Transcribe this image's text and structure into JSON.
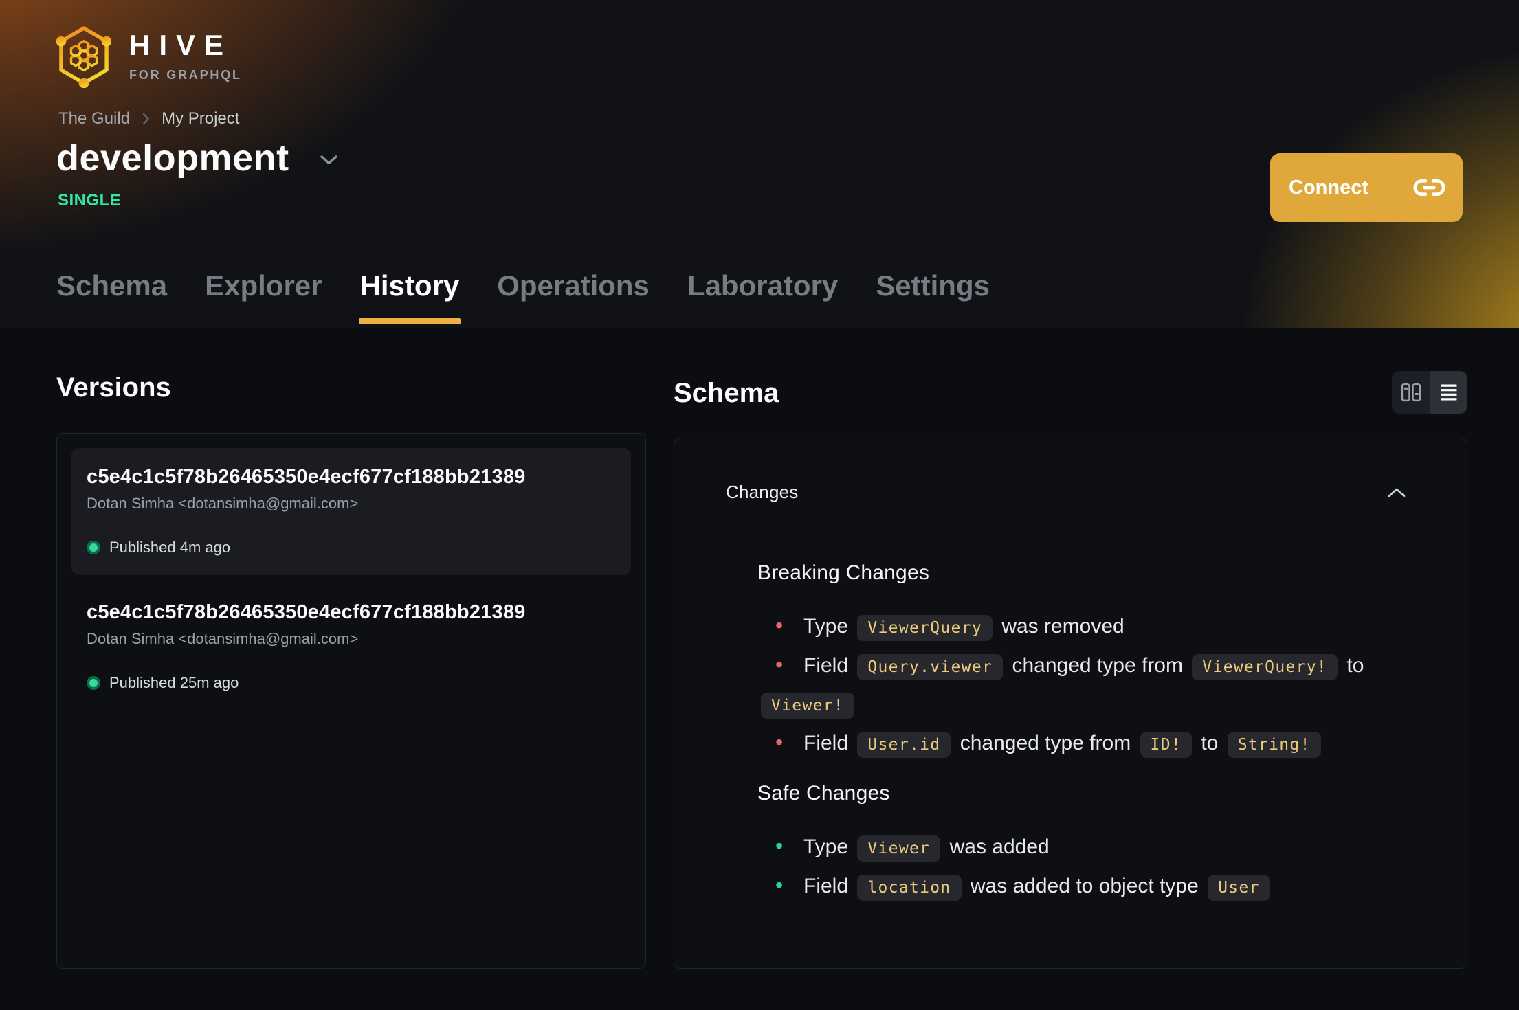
{
  "brand": {
    "name": "HIVE",
    "tagline": "FOR GRAPHQL",
    "logo_icon": "hive-honeycomb-hexagon"
  },
  "breadcrumb": {
    "items": [
      "The Guild",
      "My Project"
    ],
    "separator_icon": "chevron-right"
  },
  "target": {
    "name": "development",
    "badge": "SINGLE",
    "dropdown_icon": "chevron-down"
  },
  "actions": {
    "connect_label": "Connect",
    "connect_icon": "link-chain"
  },
  "nav": {
    "active_tab": "History",
    "tabs": [
      {
        "label": "Schema"
      },
      {
        "label": "Explorer"
      },
      {
        "label": "History"
      },
      {
        "label": "Operations"
      },
      {
        "label": "Laboratory"
      },
      {
        "label": "Settings"
      }
    ]
  },
  "versions": {
    "title": "Versions",
    "items": [
      {
        "hash": "c5e4c1c5f78b26465350e4ecf677cf188bb21389",
        "author": "Dotan Simha <dotansimha@gmail.com>",
        "status": "Published 4m ago",
        "status_icon": "green-dot",
        "selected": true
      },
      {
        "hash": "c5e4c1c5f78b26465350e4ecf677cf188bb21389",
        "author": "Dotan Simha <dotansimha@gmail.com>",
        "status": "Published 25m ago",
        "status_icon": "green-dot",
        "selected": false
      }
    ]
  },
  "schema": {
    "title": "Schema",
    "view_toggle_icons": [
      "columns-view",
      "rows-view"
    ],
    "active_view": "rows-view",
    "accordion_label": "Changes",
    "accordion_icon": "chevron-up",
    "breaking": {
      "title": "Breaking Changes",
      "items": [
        [
          {
            "text": "Type "
          },
          {
            "code": "ViewerQuery"
          },
          {
            "text": " was removed"
          }
        ],
        [
          {
            "text": "Field "
          },
          {
            "code": "Query.viewer"
          },
          {
            "text": " changed type from "
          },
          {
            "code": "ViewerQuery!"
          },
          {
            "text": " to "
          },
          {
            "code": "Viewer!"
          }
        ],
        [
          {
            "text": "Field "
          },
          {
            "code": "User.id"
          },
          {
            "text": " changed type from "
          },
          {
            "code": "ID!"
          },
          {
            "text": " to "
          },
          {
            "code": "String!"
          }
        ]
      ]
    },
    "safe": {
      "title": "Safe Changes",
      "items": [
        [
          {
            "text": "Type "
          },
          {
            "code": "Viewer"
          },
          {
            "text": " was added"
          }
        ],
        [
          {
            "text": "Field "
          },
          {
            "code": "location"
          },
          {
            "text": " was added to object type "
          },
          {
            "code": "User"
          }
        ]
      ]
    }
  },
  "colors": {
    "accent_amber": "#EEB042",
    "connect_button": "#E0A83A",
    "badge_green": "#2EE8A5",
    "breaking_bullet": "#E5646E",
    "safe_bullet": "#2DD096",
    "code_text": "#EDCB7C",
    "published_dot": "#35DA9B"
  }
}
